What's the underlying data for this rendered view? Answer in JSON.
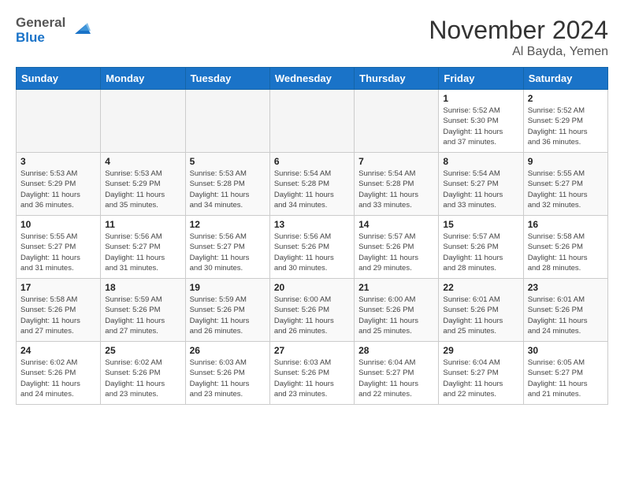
{
  "header": {
    "logo_line1": "General",
    "logo_line2": "Blue",
    "month_year": "November 2024",
    "location": "Al Bayda, Yemen"
  },
  "weekdays": [
    "Sunday",
    "Monday",
    "Tuesday",
    "Wednesday",
    "Thursday",
    "Friday",
    "Saturday"
  ],
  "weeks": [
    [
      {
        "day": "",
        "detail": ""
      },
      {
        "day": "",
        "detail": ""
      },
      {
        "day": "",
        "detail": ""
      },
      {
        "day": "",
        "detail": ""
      },
      {
        "day": "",
        "detail": ""
      },
      {
        "day": "1",
        "detail": "Sunrise: 5:52 AM\nSunset: 5:30 PM\nDaylight: 11 hours\nand 37 minutes."
      },
      {
        "day": "2",
        "detail": "Sunrise: 5:52 AM\nSunset: 5:29 PM\nDaylight: 11 hours\nand 36 minutes."
      }
    ],
    [
      {
        "day": "3",
        "detail": "Sunrise: 5:53 AM\nSunset: 5:29 PM\nDaylight: 11 hours\nand 36 minutes."
      },
      {
        "day": "4",
        "detail": "Sunrise: 5:53 AM\nSunset: 5:29 PM\nDaylight: 11 hours\nand 35 minutes."
      },
      {
        "day": "5",
        "detail": "Sunrise: 5:53 AM\nSunset: 5:28 PM\nDaylight: 11 hours\nand 34 minutes."
      },
      {
        "day": "6",
        "detail": "Sunrise: 5:54 AM\nSunset: 5:28 PM\nDaylight: 11 hours\nand 34 minutes."
      },
      {
        "day": "7",
        "detail": "Sunrise: 5:54 AM\nSunset: 5:28 PM\nDaylight: 11 hours\nand 33 minutes."
      },
      {
        "day": "8",
        "detail": "Sunrise: 5:54 AM\nSunset: 5:27 PM\nDaylight: 11 hours\nand 33 minutes."
      },
      {
        "day": "9",
        "detail": "Sunrise: 5:55 AM\nSunset: 5:27 PM\nDaylight: 11 hours\nand 32 minutes."
      }
    ],
    [
      {
        "day": "10",
        "detail": "Sunrise: 5:55 AM\nSunset: 5:27 PM\nDaylight: 11 hours\nand 31 minutes."
      },
      {
        "day": "11",
        "detail": "Sunrise: 5:56 AM\nSunset: 5:27 PM\nDaylight: 11 hours\nand 31 minutes."
      },
      {
        "day": "12",
        "detail": "Sunrise: 5:56 AM\nSunset: 5:27 PM\nDaylight: 11 hours\nand 30 minutes."
      },
      {
        "day": "13",
        "detail": "Sunrise: 5:56 AM\nSunset: 5:26 PM\nDaylight: 11 hours\nand 30 minutes."
      },
      {
        "day": "14",
        "detail": "Sunrise: 5:57 AM\nSunset: 5:26 PM\nDaylight: 11 hours\nand 29 minutes."
      },
      {
        "day": "15",
        "detail": "Sunrise: 5:57 AM\nSunset: 5:26 PM\nDaylight: 11 hours\nand 28 minutes."
      },
      {
        "day": "16",
        "detail": "Sunrise: 5:58 AM\nSunset: 5:26 PM\nDaylight: 11 hours\nand 28 minutes."
      }
    ],
    [
      {
        "day": "17",
        "detail": "Sunrise: 5:58 AM\nSunset: 5:26 PM\nDaylight: 11 hours\nand 27 minutes."
      },
      {
        "day": "18",
        "detail": "Sunrise: 5:59 AM\nSunset: 5:26 PM\nDaylight: 11 hours\nand 27 minutes."
      },
      {
        "day": "19",
        "detail": "Sunrise: 5:59 AM\nSunset: 5:26 PM\nDaylight: 11 hours\nand 26 minutes."
      },
      {
        "day": "20",
        "detail": "Sunrise: 6:00 AM\nSunset: 5:26 PM\nDaylight: 11 hours\nand 26 minutes."
      },
      {
        "day": "21",
        "detail": "Sunrise: 6:00 AM\nSunset: 5:26 PM\nDaylight: 11 hours\nand 25 minutes."
      },
      {
        "day": "22",
        "detail": "Sunrise: 6:01 AM\nSunset: 5:26 PM\nDaylight: 11 hours\nand 25 minutes."
      },
      {
        "day": "23",
        "detail": "Sunrise: 6:01 AM\nSunset: 5:26 PM\nDaylight: 11 hours\nand 24 minutes."
      }
    ],
    [
      {
        "day": "24",
        "detail": "Sunrise: 6:02 AM\nSunset: 5:26 PM\nDaylight: 11 hours\nand 24 minutes."
      },
      {
        "day": "25",
        "detail": "Sunrise: 6:02 AM\nSunset: 5:26 PM\nDaylight: 11 hours\nand 23 minutes."
      },
      {
        "day": "26",
        "detail": "Sunrise: 6:03 AM\nSunset: 5:26 PM\nDaylight: 11 hours\nand 23 minutes."
      },
      {
        "day": "27",
        "detail": "Sunrise: 6:03 AM\nSunset: 5:26 PM\nDaylight: 11 hours\nand 23 minutes."
      },
      {
        "day": "28",
        "detail": "Sunrise: 6:04 AM\nSunset: 5:27 PM\nDaylight: 11 hours\nand 22 minutes."
      },
      {
        "day": "29",
        "detail": "Sunrise: 6:04 AM\nSunset: 5:27 PM\nDaylight: 11 hours\nand 22 minutes."
      },
      {
        "day": "30",
        "detail": "Sunrise: 6:05 AM\nSunset: 5:27 PM\nDaylight: 11 hours\nand 21 minutes."
      }
    ]
  ]
}
